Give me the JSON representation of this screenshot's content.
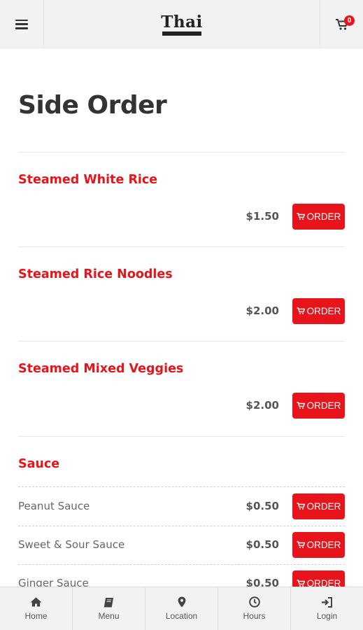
{
  "header": {
    "logo_text": "Thai",
    "cart_count": "0",
    "icons": {
      "menu": "hamburger-icon",
      "cart": "cart-icon"
    }
  },
  "page": {
    "title": "Side Order"
  },
  "items": [
    {
      "name": "Steamed White Rice",
      "price": "$1.50",
      "order_label": "ORDER"
    },
    {
      "name": "Steamed Rice Noodles",
      "price": "$2.00",
      "order_label": "ORDER"
    },
    {
      "name": "Steamed Mixed Veggies",
      "price": "$2.00",
      "order_label": "ORDER"
    }
  ],
  "sauce": {
    "title": "Sauce",
    "options": [
      {
        "name": "Peanut Sauce",
        "price": "$0.50",
        "order_label": "ORDER"
      },
      {
        "name": "Sweet & Sour Sauce",
        "price": "$0.50",
        "order_label": "ORDER"
      },
      {
        "name": "Ginger Sauce",
        "price": "$0.50",
        "order_label": "ORDER"
      }
    ]
  },
  "bottom_nav": [
    {
      "label": "Home",
      "icon": "home-icon"
    },
    {
      "label": "Menu",
      "icon": "book-icon"
    },
    {
      "label": "Location",
      "icon": "map-marker-icon"
    },
    {
      "label": "Hours",
      "icon": "clock-icon"
    },
    {
      "label": "Login",
      "icon": "login-icon"
    }
  ],
  "colors": {
    "accent": "#e8141b",
    "bar_background": "#f2f2f2",
    "text": "#333333"
  }
}
